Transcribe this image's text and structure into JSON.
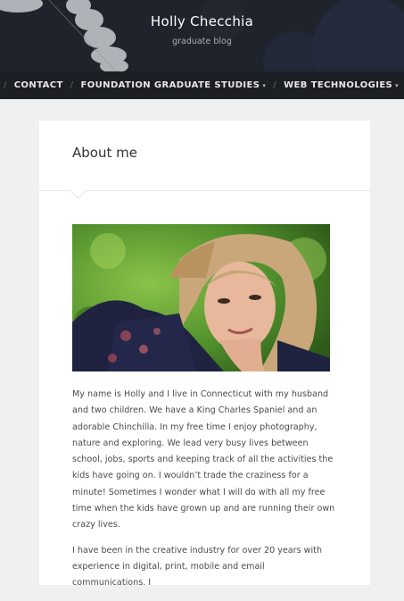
{
  "site": {
    "title": "Holly Checchia",
    "tagline": "graduate blog"
  },
  "nav": {
    "items": [
      {
        "label": "CONTACT",
        "dropdown": false
      },
      {
        "label": "FOUNDATION GRADUATE STUDIES",
        "dropdown": true
      },
      {
        "label": "WEB TECHNOLOGIES",
        "dropdown": true
      }
    ]
  },
  "page": {
    "title": "About me",
    "paragraphs": [
      "My name is Holly and I live in Connecticut with my husband and two children. We have a King Charles Spaniel and an adorable Chinchilla. In my free time I enjoy photography, nature and exploring. We lead very busy lives between school, jobs, sports and keeping track of all the activities the kids have going on. I wouldn’t trade the craziness for a minute! Sometimes I wonder what I will do with all my free time when the kids have grown up and are running their own crazy lives.",
      "I have been in the creative industry for over 20 years with experience in digital, print, mobile and email communications. I"
    ]
  },
  "colors": {
    "header_bg": "#1f242c",
    "nav_bg": "#1c1f24",
    "page_bg": "#f0f0f0"
  }
}
